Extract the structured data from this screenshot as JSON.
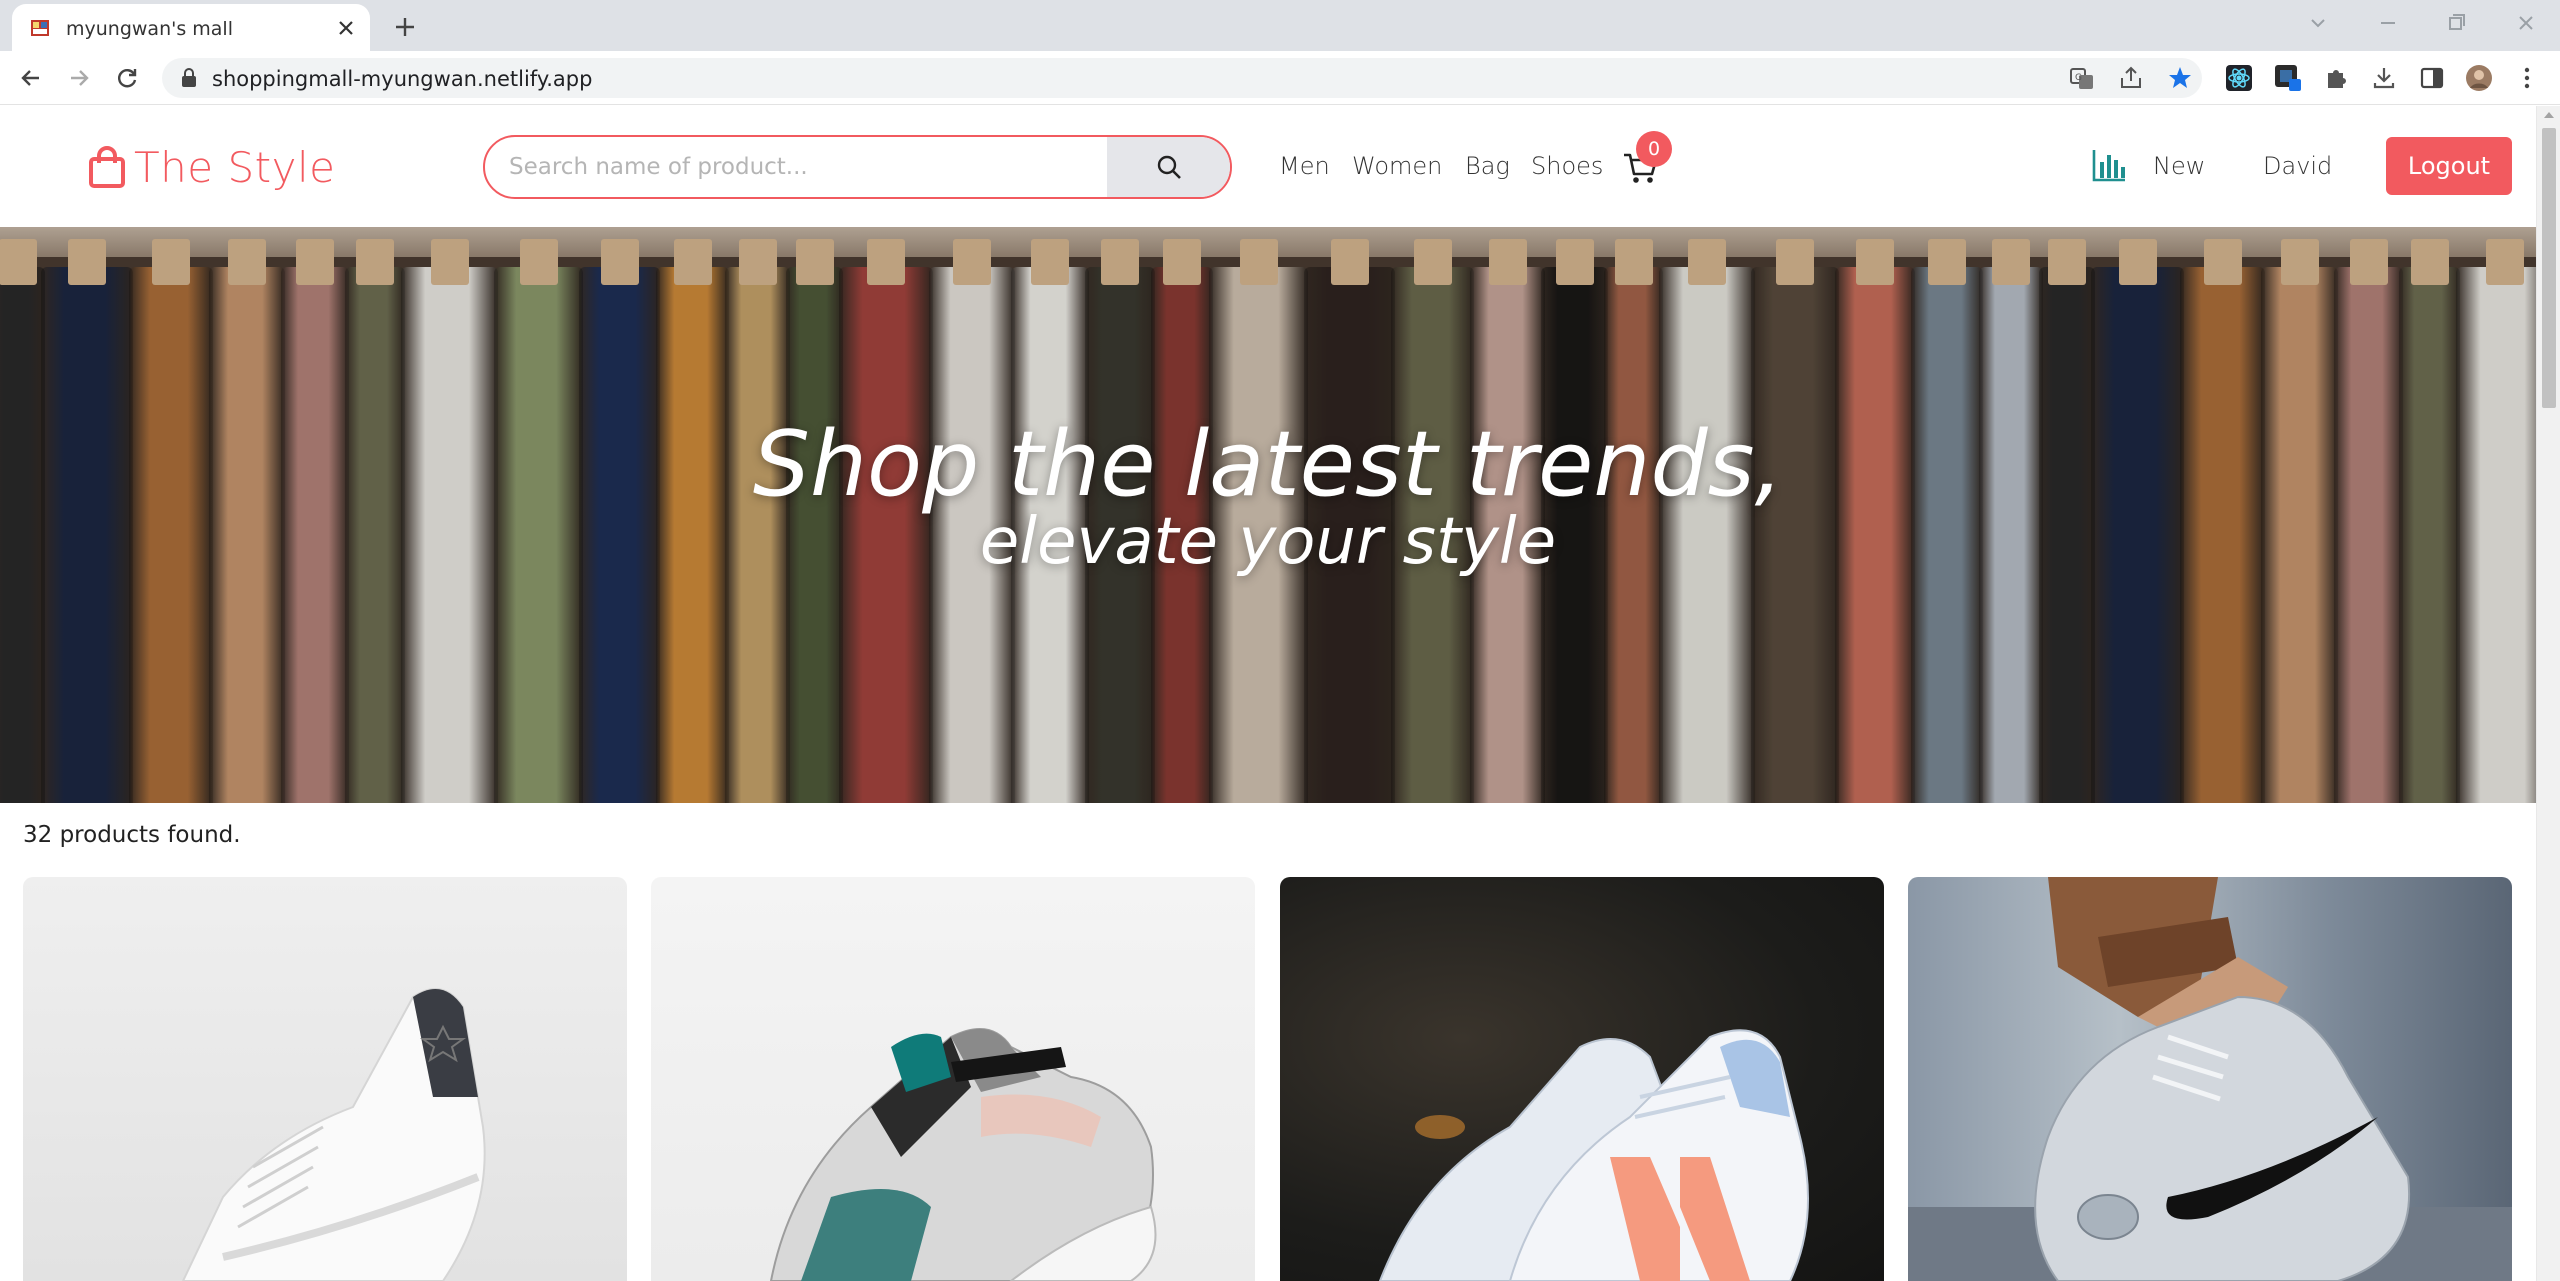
{
  "browser": {
    "tab_title": "myungwan's mall",
    "url": "shoppingmall-myungwan.netlify.app"
  },
  "header": {
    "logo_text": "The Style",
    "search_placeholder": "Search name of product...",
    "nav": [
      "Men",
      "Women",
      "Bag",
      "Shoes"
    ],
    "cart_count": "0",
    "new_label": "New",
    "user_name": "David",
    "logout_label": "Logout",
    "accent_color": "#f25a5f",
    "chart_icon_color": "#1f8f8f"
  },
  "hero": {
    "line1": "Shop the latest trends,",
    "line2": "elevate your style"
  },
  "products": {
    "count_text": "32 products found.",
    "items": [
      {
        "image": "white-sneaker-photo"
      },
      {
        "image": "calvin-klein-sneaker-photo"
      },
      {
        "image": "new-balance-sneaker-photo"
      },
      {
        "image": "nike-sneaker-photo"
      }
    ]
  }
}
